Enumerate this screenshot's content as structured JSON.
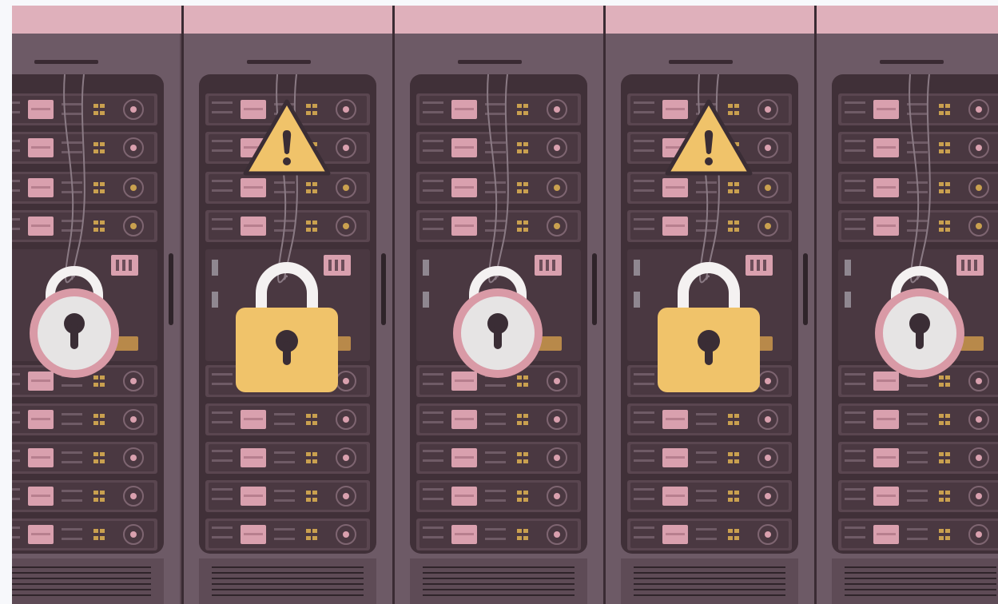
{
  "scene": {
    "description_tags": [
      "server-rack-icon",
      "padlock-icon",
      "warning-icon"
    ],
    "colors": {
      "page_bg": "#f7f8fb",
      "top_band": "#dfb0bb",
      "rack_frame": "#6d5a66",
      "rack_inner": "#403038",
      "slot": "#5a4650",
      "drive_pink": "#d9a0ae",
      "led_amber": "#c9a04f",
      "lock_gold": "#f0c36a",
      "lock_pink_ring": "#d99aa6",
      "lock_face": "#e6e4e4",
      "keyhole": "#3a2d35",
      "warning_fill": "#f0c36a"
    }
  },
  "racks": [
    {
      "name": "rack-1",
      "lock": "round",
      "warning": false
    },
    {
      "name": "rack-2",
      "lock": "padlock",
      "warning": true
    },
    {
      "name": "rack-3",
      "lock": "round",
      "warning": false
    },
    {
      "name": "rack-4",
      "lock": "padlock",
      "warning": true
    },
    {
      "name": "rack-5",
      "lock": "round",
      "warning": false
    }
  ]
}
